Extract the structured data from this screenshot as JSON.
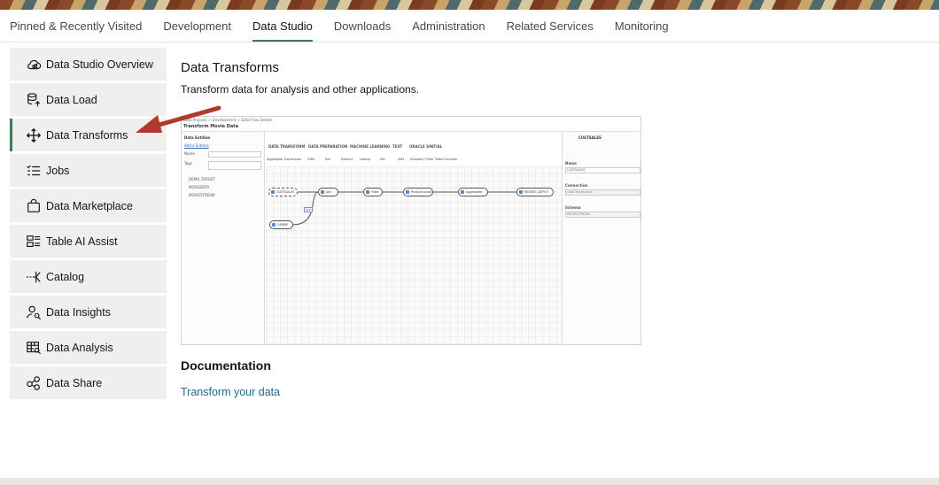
{
  "tabs": [
    {
      "label": "Pinned & Recently Visited",
      "active": false
    },
    {
      "label": "Development",
      "active": false
    },
    {
      "label": "Data Studio",
      "active": true
    },
    {
      "label": "Downloads",
      "active": false
    },
    {
      "label": "Administration",
      "active": false
    },
    {
      "label": "Related Services",
      "active": false
    },
    {
      "label": "Monitoring",
      "active": false
    }
  ],
  "sidebar": {
    "items": [
      {
        "label": "Data Studio Overview",
        "icon": "cloud-icon",
        "active": false
      },
      {
        "label": "Data Load",
        "icon": "database-upload-icon",
        "active": false
      },
      {
        "label": "Data Transforms",
        "icon": "move-arrows-icon",
        "active": true
      },
      {
        "label": "Jobs",
        "icon": "checklist-icon",
        "active": false
      },
      {
        "label": "Data Marketplace",
        "icon": "shopping-bag-icon",
        "active": false
      },
      {
        "label": "Table AI Assist",
        "icon": "table-list-icon",
        "active": false
      },
      {
        "label": "Catalog",
        "icon": "catalog-icon",
        "active": false
      },
      {
        "label": "Data Insights",
        "icon": "person-search-icon",
        "active": false
      },
      {
        "label": "Data Analysis",
        "icon": "table-search-icon",
        "active": false
      },
      {
        "label": "Data Share",
        "icon": "share-nodes-icon",
        "active": false
      }
    ]
  },
  "main": {
    "title": "Data Transforms",
    "subtitle": "Transform data for analysis and other applications.",
    "documentation_title": "Documentation",
    "documentation_link": "Transform your data"
  },
  "preview": {
    "breadcrumb": "Data Projects > Development > Data Flow Details",
    "title": "Transform Movie Data",
    "left_title": "Data Entities",
    "add_entities": "Add a Entities",
    "name_label": "Name",
    "tags_label": "Tags",
    "entities": [
      "DEMO_TARGET",
      "MOVIEDATA",
      "MOVIESTREAM"
    ],
    "menu": [
      "DATA TRANSFORM",
      "DATA PREPARATION",
      "MACHINE LEARNING",
      "TEXT",
      "ORACLE SPATIAL"
    ],
    "tools": [
      "Aggregate",
      "Expression",
      "Filter",
      "Join",
      "Distinct",
      "Lookup",
      "Set",
      "Sort",
      "Subquery Filter",
      "Table Function"
    ],
    "nodes": [
      "CUSTSALES",
      "Join",
      "Filter",
      "Pivot/Unpivot",
      "Aggregate",
      "MOVIES_DEPOT"
    ],
    "bottom_node": "GENRE",
    "join_label": "Join",
    "right_title": "CUSTSALES",
    "right_fields": [
      {
        "label": "Name",
        "value": "CUSTSALES"
      },
      {
        "label": "Connection",
        "value": "Data Warehouse"
      },
      {
        "label": "Schema",
        "value": "MOVIESTREAM"
      }
    ]
  },
  "colors": {
    "accent": "#3f7a5b",
    "link": "#1e6b8a",
    "arrow": "#b03a2e",
    "sidebar_bg": "#f1efed"
  }
}
